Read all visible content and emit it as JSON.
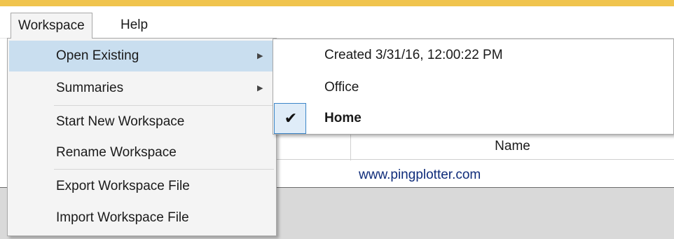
{
  "menubar": {
    "items": [
      {
        "label": "Workspace"
      },
      {
        "label": "Help"
      }
    ]
  },
  "workspace_menu": {
    "items": [
      {
        "label": "Open Existing",
        "has_submenu": true,
        "highlighted": true
      },
      {
        "label": "Summaries",
        "has_submenu": true
      },
      {
        "label": "Start New Workspace"
      },
      {
        "label": "Rename Workspace"
      },
      {
        "label": "Export Workspace File"
      },
      {
        "label": "Import Workspace File"
      }
    ],
    "submenu_arrow": "▶"
  },
  "open_existing_submenu": {
    "items": [
      {
        "label": "Created 3/31/16, 12:00:22 PM"
      },
      {
        "label": "Office"
      },
      {
        "label": "Home",
        "checked": true
      }
    ],
    "check_glyph": "✔"
  },
  "grid": {
    "column_header": "Name",
    "rows": [
      {
        "name": "www.pingplotter.com"
      }
    ]
  },
  "colors": {
    "title_strip": "#f0c44e",
    "menu_highlight": "#c9deef",
    "check_border": "#3c86c8",
    "link_text": "#0f2c7a"
  }
}
